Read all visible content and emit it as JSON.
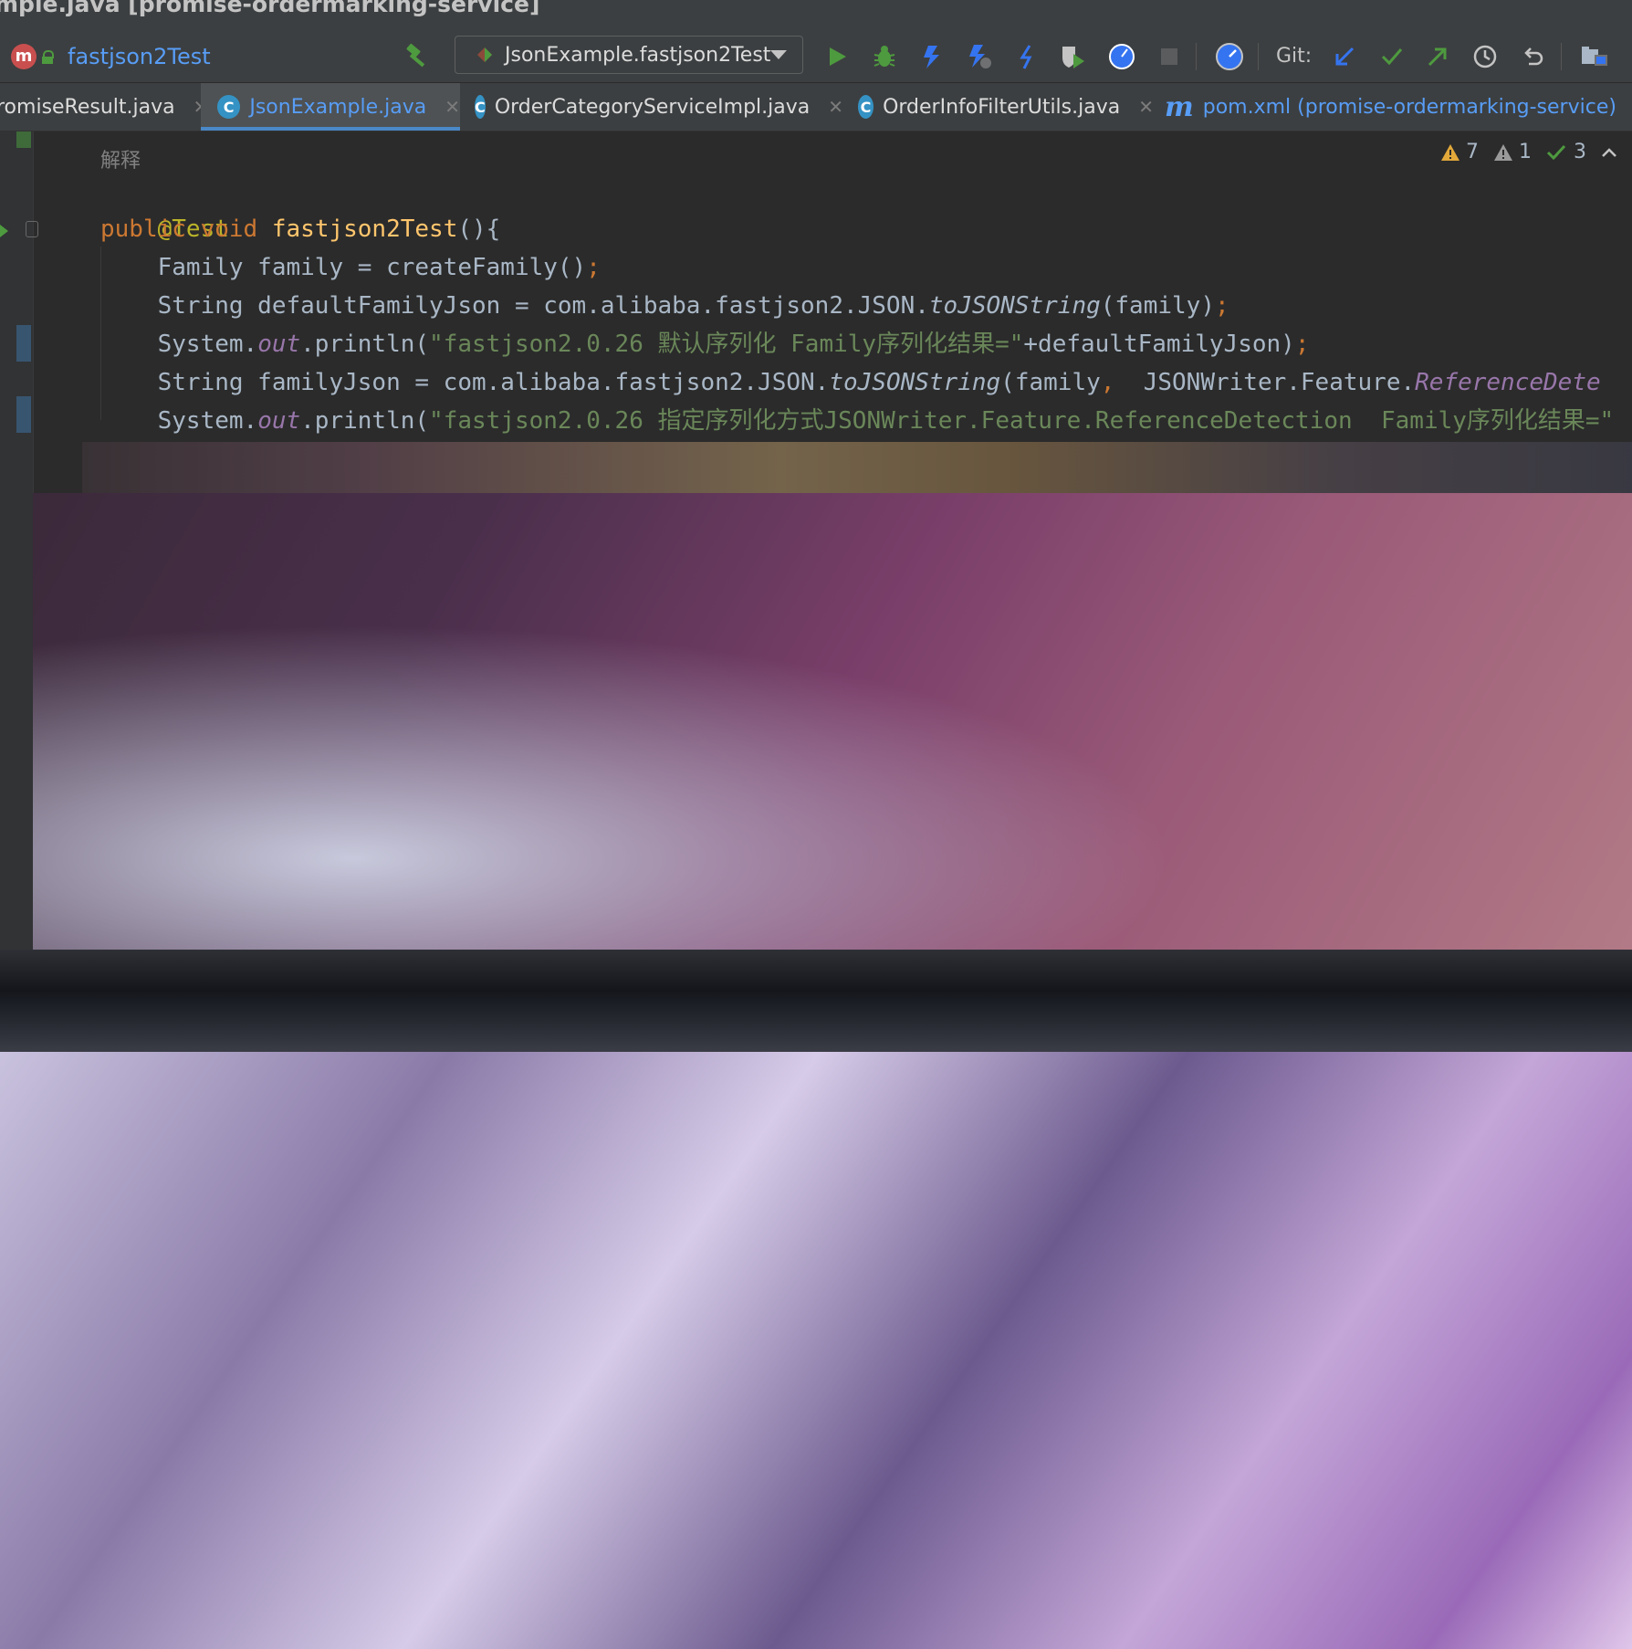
{
  "window": {
    "title": "mple.java [promise-ordermarking-service]"
  },
  "toolbar": {
    "breadcrumb_badge": "m",
    "breadcrumb_label": "fastjson2Test",
    "run_config_label": "JsonExample.fastjson2Test",
    "git_label": "Git:",
    "icons": [
      "build-hammer-icon",
      "run-icon",
      "debug-icon",
      "coverage-icon",
      "profiler-icon",
      "run-with-icon",
      "attach-debugger-icon",
      "profiler-dial-icon",
      "stop-icon",
      "find-action-icon",
      "git-update-icon",
      "git-commit-icon",
      "git-push-icon",
      "git-history-icon",
      "git-rollback-icon",
      "project-structure-icon"
    ],
    "colors": {
      "blue": "#589df6",
      "green": "#4e9a3f"
    }
  },
  "tabs": [
    {
      "label": "romiseResult.java",
      "active": false
    },
    {
      "label": "JsonExample.java",
      "active": true
    },
    {
      "label": "OrderCategoryServiceImpl.java",
      "active": false
    },
    {
      "label": "OrderInfoFilterUtils.java",
      "active": false
    },
    {
      "label": "pom.xml (promise-ordermarking-service)",
      "active": false
    }
  ],
  "tab_icons": {
    "class": "C",
    "maven": "m"
  },
  "editor": {
    "hint": "解释",
    "inspections": {
      "warnings": "7",
      "weak_warnings": "1",
      "ok": "3"
    },
    "lines": {
      "l1": {
        "annotation": "@Test"
      },
      "l2": {
        "kw1": "public ",
        "kw2": "void ",
        "name": "fastjson2Test",
        "rest": "(){"
      },
      "l3": {
        "text": "    Family family = createFamily()",
        "semi": ";"
      },
      "l4": {
        "pre": "    String defaultFamilyJson = com.alibaba.fastjson2.JSON.",
        "method": "toJSONString",
        "post": "(family)",
        "semi": ";"
      },
      "l5": {
        "pre": "    System.",
        "field": "out",
        "mid": ".println(",
        "str": "\"fastjson2.0.26 默认序列化 Family序列化结果=\"",
        "post": "+defaultFamilyJson)",
        "semi": ";"
      },
      "l6": {
        "pre": "    String familyJson = com.alibaba.fastjson2.JSON.",
        "method": "toJSONString",
        "mid": "(family",
        "comma": ",",
        "post": "  JSONWriter.Feature.",
        "field": "ReferenceDete"
      },
      "l7": {
        "pre": "    System.",
        "field": "out",
        "mid": ".println(",
        "str": "\"fastjson2.0.26 指定序列化方式JSONWriter.Feature.ReferenceDetection  Family序列化结果=\""
      }
    },
    "colors": {
      "keyword": "#cc7832",
      "function": "#ffc66d",
      "annotation": "#bbb529",
      "string": "#6a8759",
      "field": "#9876aa",
      "text": "#a9b7c6",
      "background": "#2b2b2b"
    }
  }
}
